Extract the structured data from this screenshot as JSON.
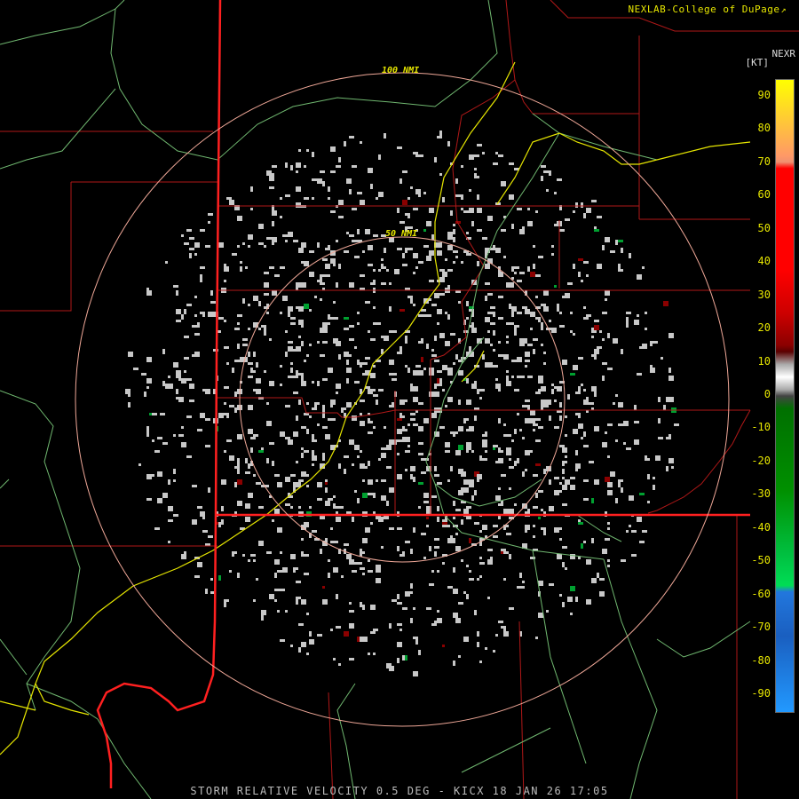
{
  "credit": "NEXLAB-College of DuPage",
  "credit_icon": "logo-icon",
  "product": "NEXR",
  "unit": "[KT]",
  "caption": "STORM RELATIVE VELOCITY 0.5 DEG - KICX 18 JAN 26 17:05",
  "rings": [
    {
      "label": "50 NMI",
      "radius_nmi": 50
    },
    {
      "label": "100 NMI",
      "radius_nmi": 100
    }
  ],
  "scale": {
    "ticks": [
      "90",
      "80",
      "70",
      "60",
      "50",
      "40",
      "30",
      "20",
      "10",
      "0",
      "-10",
      "-20",
      "-30",
      "-40",
      "-50",
      "-60",
      "-70",
      "-80",
      "-90"
    ],
    "range": [
      -95,
      95
    ],
    "colors": {
      "above_70": "#f09070",
      "high": "#ff0000",
      "mid_pos": "#8b0000",
      "near_zero": "#aaaaaa",
      "neg": "#007000",
      "neg_strong": "#00dd55",
      "neg_extreme": "#2277dd",
      "top": "#ffff00",
      "bottom": "#2299ff"
    }
  },
  "colors": {
    "state_border": "#ff2020",
    "county_border": "#b01818",
    "highway": "#e6e600",
    "river": "#70b870",
    "ring": "#f0a898",
    "echo": "#c8c8c8"
  }
}
